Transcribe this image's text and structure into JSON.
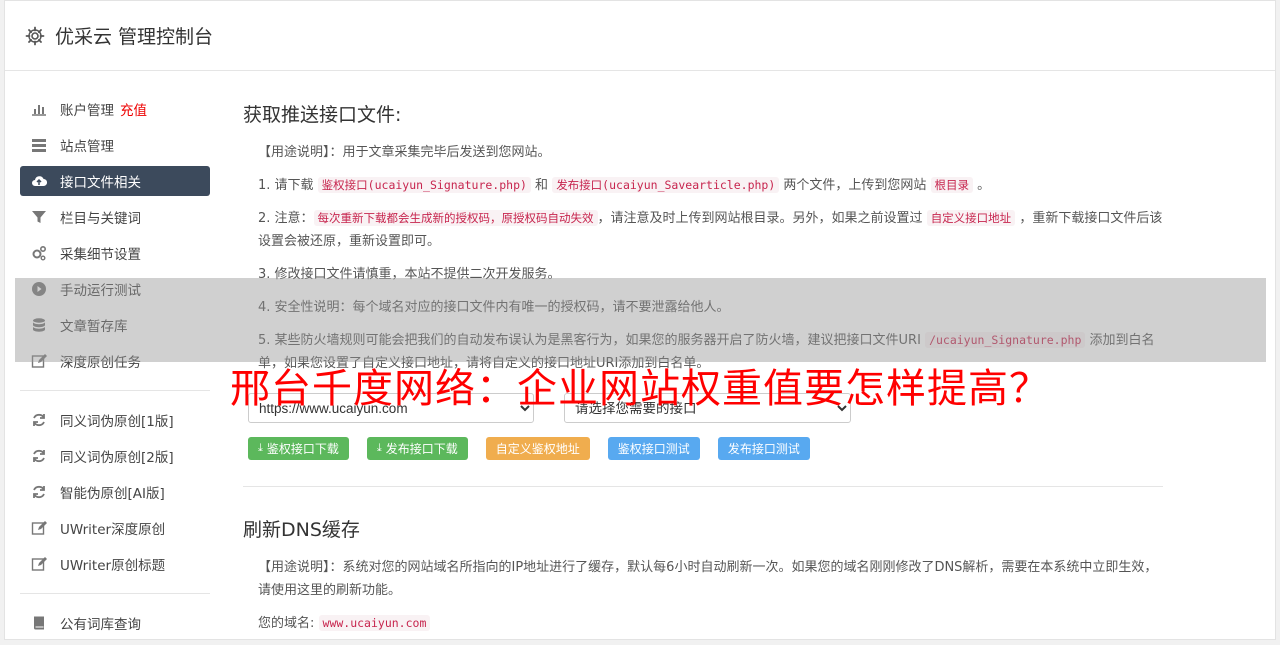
{
  "header": {
    "title": "优采云 管理控制台"
  },
  "sidebar": {
    "items": [
      {
        "label": "账户管理",
        "extra": "充值",
        "icon": "bar-chart-icon"
      },
      {
        "label": "站点管理",
        "icon": "server-icon"
      },
      {
        "label": "接口文件相关",
        "icon": "cloud-upload-icon",
        "active": true
      },
      {
        "label": "栏目与关键词",
        "icon": "filter-icon"
      },
      {
        "label": "采集细节设置",
        "icon": "cogs-icon"
      },
      {
        "label": "手动运行测试",
        "icon": "play-circle-icon"
      },
      {
        "label": "文章暂存库",
        "icon": "database-icon"
      },
      {
        "label": "深度原创任务",
        "icon": "edit-icon"
      }
    ],
    "items2": [
      {
        "label": "同义词伪原创[1版]",
        "icon": "refresh-icon"
      },
      {
        "label": "同义词伪原创[2版]",
        "icon": "refresh-icon"
      },
      {
        "label": "智能伪原创[AI版]",
        "icon": "refresh-icon"
      },
      {
        "label": "UWriter深度原创",
        "icon": "edit-icon"
      },
      {
        "label": "UWriter原创标题",
        "icon": "edit-icon"
      }
    ],
    "items3": [
      {
        "label": "公有词库查询",
        "icon": "book-icon"
      }
    ]
  },
  "section1": {
    "title": "获取推送接口文件:",
    "usage": "【用途说明】：用于文章采集完毕后发送到您网站。",
    "p1_a": "1. 请下载 ",
    "p1_code1": "鉴权接口(ucaiyun_Signature.php)",
    "p1_b": " 和 ",
    "p1_code2": "发布接口(ucaiyun_Savearticle.php)",
    "p1_c": " 两个文件，上传到您网站 ",
    "p1_code3": "根目录",
    "p1_d": " 。",
    "p2_a": "2. 注意：",
    "p2_code1": "每次重新下载都会生成新的授权码，原授权码自动失效",
    "p2_b": "，请注意及时上传到网站根目录。另外，如果之前设置过 ",
    "p2_code2": "自定义接口地址",
    "p2_c": " ，重新下载接口文件后该设置会被还原，重新设置即可。",
    "p3": "3. 修改接口文件请慎重，本站不提供二次开发服务。",
    "p4": "4. 安全性说明：每个域名对应的接口文件内有唯一的授权码，请不要泄露给他人。",
    "p5_a": "5. 某些防火墙规则可能会把我们的自动发布误认为是黑客行为，如果您的服务器开启了防火墙，建议把接口文件URI ",
    "p5_code": "/ucaiyun_Signature.php",
    "p5_b": " 添加到白名单，如果您设置了自定义接口地址，请将自定义的接口地址URI添加到白名单。",
    "select_site": "https://www.ucaiyun.com",
    "select_api": "请选择您需要的接口",
    "buttons": {
      "download_sig": "鉴权接口下载",
      "download_pub": "发布接口下载",
      "custom_sig": "自定义鉴权地址",
      "test_sig": "鉴权接口测试",
      "test_pub": "发布接口测试"
    }
  },
  "section2": {
    "title": "刷新DNS缓存",
    "usage": "【用途说明】：系统对您的网站域名所指向的IP地址进行了缓存，默认每6小时自动刷新一次。如果您的域名刚刚修改了DNS解析，需要在本系统中立即生效，请使用这里的刷新功能。",
    "domain_label": "您的域名: ",
    "domain_value": "www.ucaiyun.com"
  },
  "overlay_headline": "邢台千度网络：企业网站权重值要怎样提高？"
}
